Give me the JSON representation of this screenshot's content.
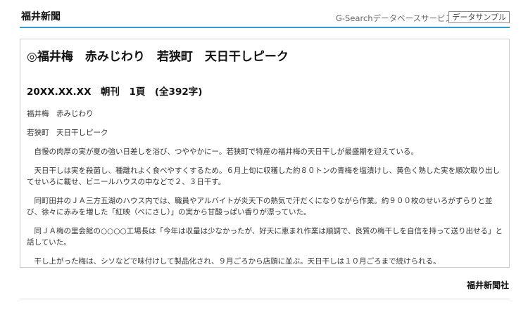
{
  "header": {
    "brand": "福井新聞",
    "service": "G-Searchデータベースサービス",
    "sample_badge": "データサンプル"
  },
  "article": {
    "title": "◎福井梅　赤みじわり　若狭町　天日干しピーク",
    "meta": "20XX.XX.XX　朝刊　1頁　(全392字)",
    "paragraphs": [
      "福井梅　赤みじわり",
      "若狭町　天日干しピーク",
      "自慢の肉厚の実が夏の強い日差しを浴び、つややかにー。若狭町で特産の福井梅の天日干しが最盛期を迎えている。",
      "天日干しは実を殺菌し、種離れよく食べやすくするため。６月上旬に収穫した約８０トンの青梅を塩漬けし、黄色く熟した実を順次取り出してせいろに載せ、ビニールハウスの中などで２、３日干す。",
      "同町田井のＪＡ三方五湖のハウス内では、職員やアルバイトが炎天下の熱気で汗だくになりながら作業。約９００枚のせいろがずらりと並び、徐々に赤みを増した「紅映（べにさし）」の実から甘酸っぱい香りが漂っていた。",
      "同ＪＡ梅の里会館の○○○○工場長は「今年は収量は少なかったが、好天に恵まれ作業は順調で、良質の梅干しを自信を持って送り出せる」と話していた。",
      "干し上がった梅は、シソなどで味付けして製品化され、９月ごろから店頭に並ぶ。天日干しは１０月ごろまで続けられる。"
    ]
  },
  "footer": {
    "publisher": "福井新聞社"
  }
}
